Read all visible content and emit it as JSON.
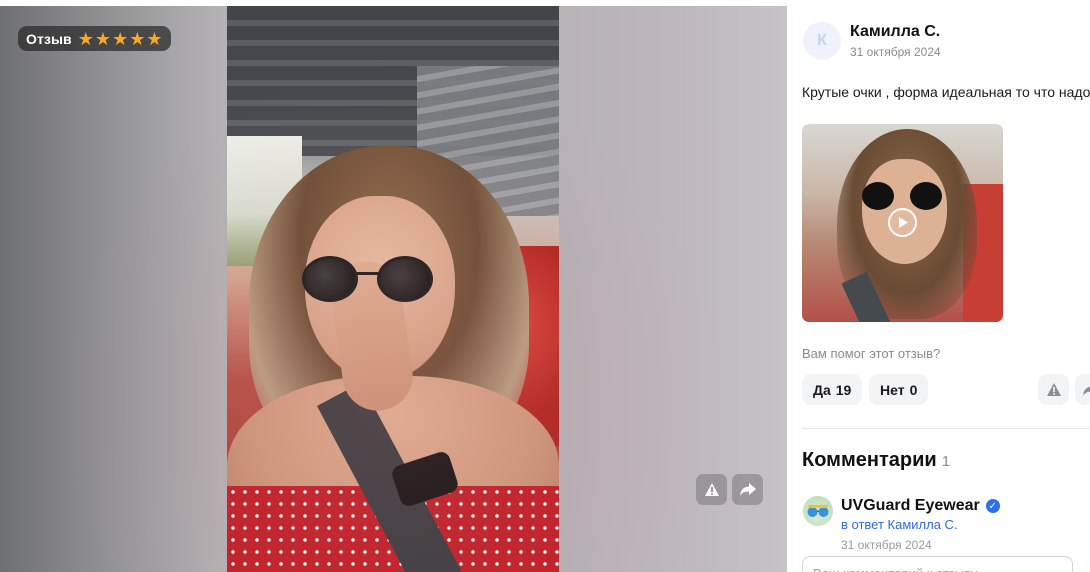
{
  "viewer": {
    "badge_label": "Отзыв",
    "rating": 5,
    "rating_max": 5
  },
  "review": {
    "author_initial": "К",
    "author_name": "Камилла С.",
    "date": "31 октября 2024",
    "text": "Крутые очки , форма идеальная то что надо",
    "helpful_question": "Вам помог этот отзыв?",
    "yes_label": "Да",
    "yes_count": "19",
    "no_label": "Нет",
    "no_count": "0"
  },
  "comments": {
    "title": "Комментарии",
    "count": "1",
    "items": [
      {
        "author": "UVGuard Eyewear",
        "verified": true,
        "reply_to": "в ответ Камилла С.",
        "date": "31 октября 2024"
      }
    ],
    "input_placeholder": "Ваш комментарий к отзыву"
  },
  "colors": {
    "star": "#f9a824",
    "link": "#2f6bdc",
    "verified": "#2c6ff0",
    "muted_text": "#8a8a8a",
    "button_bg": "#f2f3f5"
  },
  "icons": {
    "warn": "warning-icon",
    "share": "share-icon",
    "play": "play-icon",
    "verified": "verified-badge-icon"
  }
}
